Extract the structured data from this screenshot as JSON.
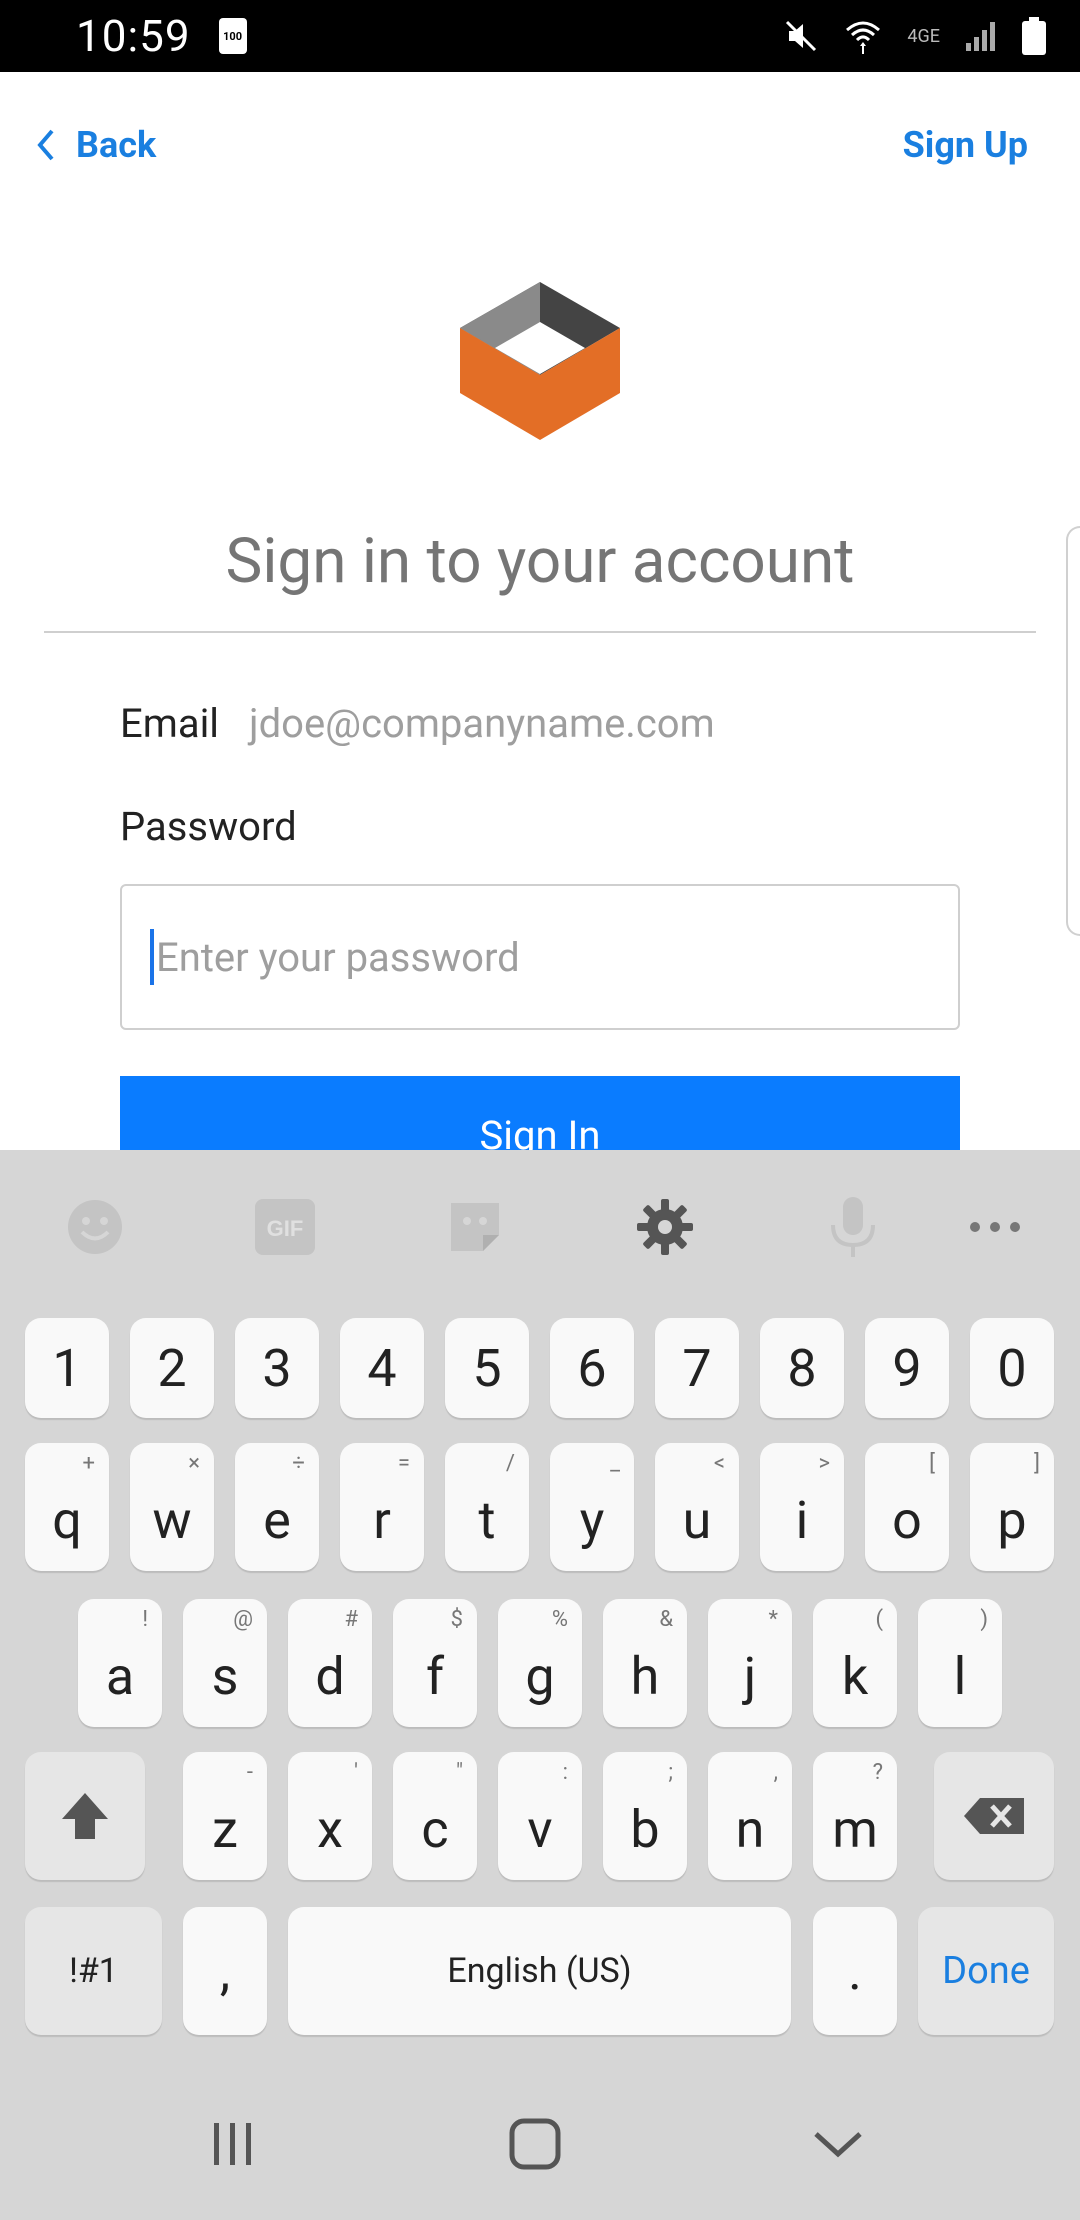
{
  "status_bar": {
    "time": "10:59",
    "sim_label": "100",
    "network": "4GE"
  },
  "nav": {
    "back_label": "Back",
    "signup_label": "Sign Up"
  },
  "colors": {
    "accent": "#1a7fe0",
    "button": "#0a7cff",
    "logo_orange": "#e36e26",
    "logo_gray": "#8a8a8a",
    "logo_dark": "#444444"
  },
  "form": {
    "title": "Sign in to your account",
    "email_label": "Email",
    "email_value": "jdoe@companyname.com",
    "password_label": "Password",
    "password_placeholder": "Enter your password",
    "signin_label": "Sign In"
  },
  "keyboard": {
    "toolbar": [
      "emoji-icon",
      "gif-icon",
      "sticker-icon",
      "gear-icon",
      "mic-icon",
      "more-icon"
    ],
    "gif_label": "GIF",
    "numbers": [
      "1",
      "2",
      "3",
      "4",
      "5",
      "6",
      "7",
      "8",
      "9",
      "0"
    ],
    "row1": [
      {
        "key": "q",
        "sub": "+"
      },
      {
        "key": "w",
        "sub": "×"
      },
      {
        "key": "e",
        "sub": "÷"
      },
      {
        "key": "r",
        "sub": "="
      },
      {
        "key": "t",
        "sub": "/"
      },
      {
        "key": "y",
        "sub": "_"
      },
      {
        "key": "u",
        "sub": "<"
      },
      {
        "key": "i",
        "sub": ">"
      },
      {
        "key": "o",
        "sub": "["
      },
      {
        "key": "p",
        "sub": "]"
      }
    ],
    "row2": [
      {
        "key": "a",
        "sub": "!"
      },
      {
        "key": "s",
        "sub": "@"
      },
      {
        "key": "d",
        "sub": "#"
      },
      {
        "key": "f",
        "sub": "$"
      },
      {
        "key": "g",
        "sub": "%"
      },
      {
        "key": "h",
        "sub": "&"
      },
      {
        "key": "j",
        "sub": "*"
      },
      {
        "key": "k",
        "sub": "("
      },
      {
        "key": "l",
        "sub": ")"
      }
    ],
    "row3": [
      {
        "key": "z",
        "sub": "-"
      },
      {
        "key": "x",
        "sub": "'"
      },
      {
        "key": "c",
        "sub": "\""
      },
      {
        "key": "v",
        "sub": ":"
      },
      {
        "key": "b",
        "sub": ";"
      },
      {
        "key": "n",
        "sub": ","
      },
      {
        "key": "m",
        "sub": "?"
      }
    ],
    "symbols_label": "!#1",
    "comma_label": ",",
    "space_label": "English (US)",
    "period_label": ".",
    "done_label": "Done"
  },
  "system_nav": [
    "recents-icon",
    "home-icon",
    "back-chevron-icon"
  ]
}
